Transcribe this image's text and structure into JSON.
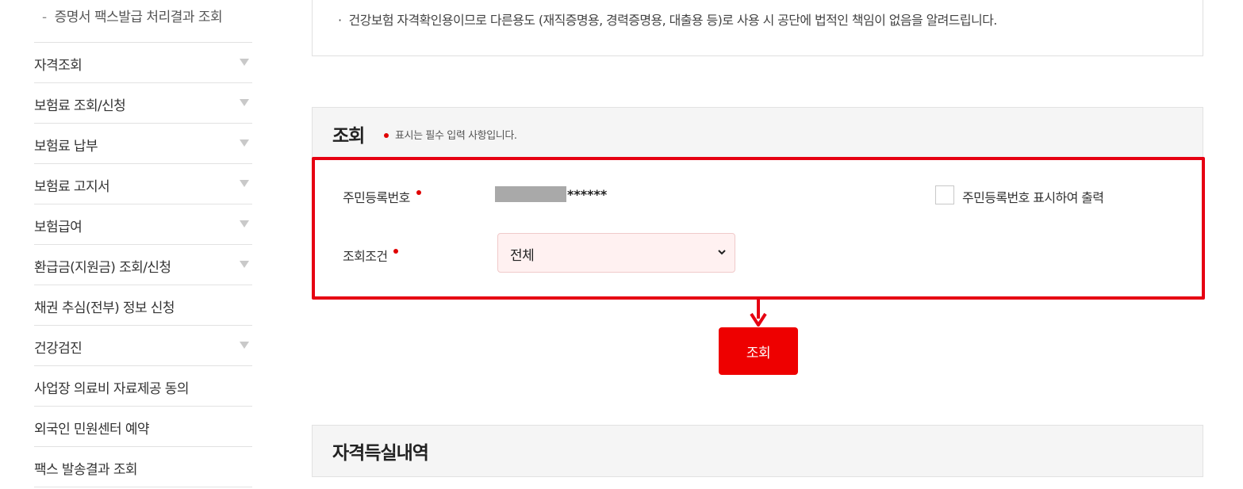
{
  "sidebar": {
    "sub_item": "증명서 팩스발급 처리결과 조회",
    "items": [
      {
        "label": "자격조회",
        "expandable": true
      },
      {
        "label": "보험료 조회/신청",
        "expandable": true
      },
      {
        "label": "보험료 납부",
        "expandable": true
      },
      {
        "label": "보험료 고지서",
        "expandable": true
      },
      {
        "label": "보험급여",
        "expandable": true
      },
      {
        "label": "환급금(지원금) 조회/신청",
        "expandable": true
      },
      {
        "label": "채권 추심(전부) 정보 신청",
        "expandable": false
      },
      {
        "label": "건강검진",
        "expandable": true
      },
      {
        "label": "사업장 의료비 자료제공 동의",
        "expandable": false
      },
      {
        "label": "외국인 민원센터 예약",
        "expandable": false
      },
      {
        "label": "팩스 발송결과 조회",
        "expandable": false
      }
    ]
  },
  "notice": {
    "text": "건강보험 자격확인용이므로 다른용도 (재직증명용, 경력증명용, 대출용 등)로 사용 시 공단에 법적인 책임이 없음을 알려드립니다."
  },
  "query": {
    "title": "조회",
    "required_note": "표시는 필수 입력 사항입니다.",
    "rrn_label": "주민등록번호",
    "rrn_masked_value": "******",
    "print_checkbox_label": "주민등록번호 표시하여 출력",
    "print_checkbox_checked": false,
    "condition_label": "조회조건",
    "condition_selected": "전체",
    "submit_label": "조회"
  },
  "history": {
    "title": "자격득실내역"
  },
  "colors": {
    "accent_red": "#ee0000",
    "highlight_border": "#e60012",
    "required_dot": "#e00000",
    "select_bg": "#fff1f1"
  }
}
